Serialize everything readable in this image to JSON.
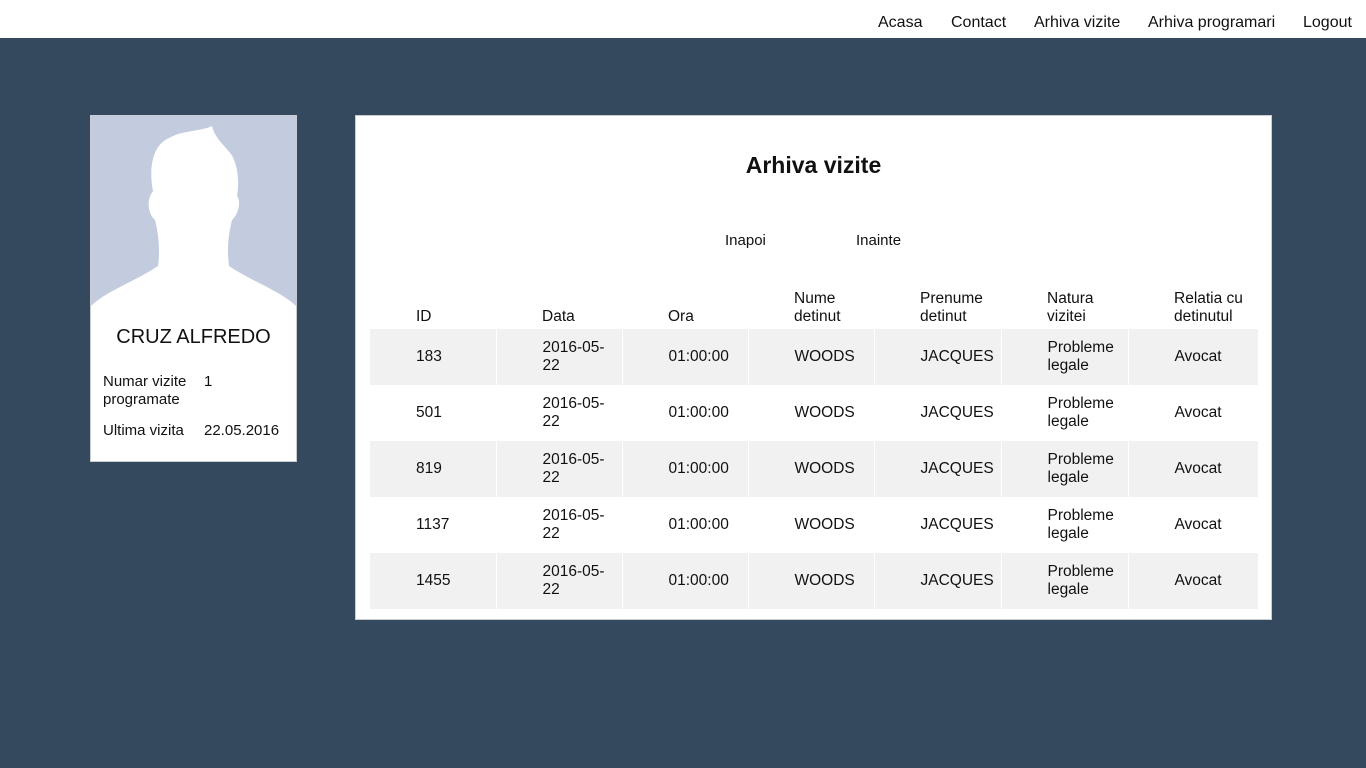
{
  "nav": {
    "items": [
      "Acasa",
      "Contact",
      "Arhiva vizite",
      "Arhiva programari",
      "Logout"
    ]
  },
  "profile": {
    "avatar_icon": "user-silhouette-icon",
    "name": "CRUZ ALFREDO",
    "stats": [
      {
        "label": "Numar vizite programate",
        "value": "1"
      },
      {
        "label": "Ultima vizita",
        "value": "22.05.2016"
      }
    ]
  },
  "main": {
    "title": "Arhiva vizite",
    "pager": {
      "prev": "Inapoi",
      "next": "Inainte"
    },
    "table": {
      "headers": [
        "ID",
        "Data",
        "Ora",
        "Nume detinut",
        "Prenume detinut",
        "Natura vizitei",
        "Relatia cu detinutul"
      ],
      "rows": [
        [
          "183",
          "2016-05-22",
          "01:00:00",
          "WOODS",
          "JACQUES",
          "Probleme legale",
          "Avocat"
        ],
        [
          "501",
          "2016-05-22",
          "01:00:00",
          "WOODS",
          "JACQUES",
          "Probleme legale",
          "Avocat"
        ],
        [
          "819",
          "2016-05-22",
          "01:00:00",
          "WOODS",
          "JACQUES",
          "Probleme legale",
          "Avocat"
        ],
        [
          "1137",
          "2016-05-22",
          "01:00:00",
          "WOODS",
          "JACQUES",
          "Probleme legale",
          "Avocat"
        ],
        [
          "1455",
          "2016-05-22",
          "01:00:00",
          "WOODS",
          "JACQUES",
          "Probleme legale",
          "Avocat"
        ]
      ]
    }
  },
  "colors": {
    "page_background": "#35495e",
    "avatar_background": "#c3cbdf",
    "row_stripe": "#f1f1f1"
  }
}
